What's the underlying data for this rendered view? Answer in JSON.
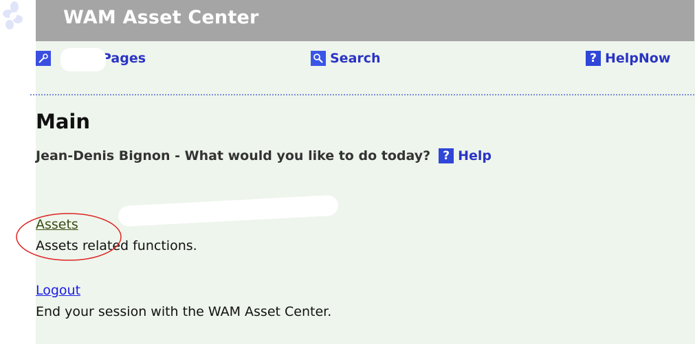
{
  "app": {
    "title": "WAM Asset Center"
  },
  "nav": {
    "pages": {
      "label": "Pages",
      "icon": "wrench-icon"
    },
    "search": {
      "label": "Search",
      "icon": "magnifier-icon"
    },
    "helpnow": {
      "label": "HelpNow",
      "icon": "question-mark-icon"
    }
  },
  "main": {
    "heading": "Main",
    "greeting": "Jean-Denis Bignon - What would you like to do today?",
    "help_label": "Help",
    "help_icon_glyph": "?"
  },
  "links": [
    {
      "label": "Assets",
      "description": "Assets related functions."
    },
    {
      "label": "Logout",
      "description": "End your session with the WAM Asset Center."
    }
  ],
  "colors": {
    "title_bar": "#a5a5a5",
    "panel_background": "#eef5ec",
    "nav_link": "#2a33c4",
    "annotation_circle": "#dd2222"
  }
}
